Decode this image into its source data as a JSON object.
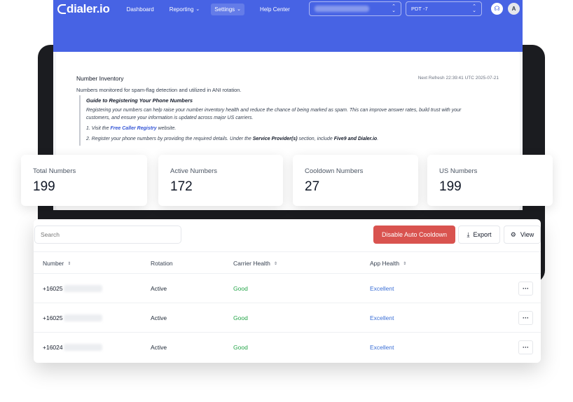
{
  "nav": {
    "logo": "dialer.io",
    "items": [
      {
        "label": "Dashboard"
      },
      {
        "label": "Reporting"
      },
      {
        "label": "Settings"
      },
      {
        "label": "Help Center"
      }
    ],
    "timezone": "PDT -7",
    "avatar_initial": "A"
  },
  "inventory": {
    "title": "Number Inventory",
    "refresh": "Next Refresh 22:39:41 UTC 2025-07-21",
    "subtitle": "Numbers monitored for spam-flag detection and utilized in ANI rotation.",
    "guide_title": "Guide to Registering Your Phone Numbers",
    "guide_body": "Registering your numbers can help raise your number inventory health and reduce the chance of being marked as spam. This can improve answer rates, build trust with your customers, and ensure your information is updated across major US carriers.",
    "step1_prefix": "1. Visit the ",
    "step1_link": "Free Caller Registry",
    "step1_suffix": " website.",
    "step2_prefix": "2. Register your phone numbers by providing the required details. Under the ",
    "step2_bold": "Service Provider(s)",
    "step2_mid": " section, include ",
    "step2_bold2": "Five9 and Dialer.io",
    "step2_end": "."
  },
  "stats": [
    {
      "label": "Total Numbers",
      "value": "199"
    },
    {
      "label": "Active Numbers",
      "value": "172"
    },
    {
      "label": "Cooldown Numbers",
      "value": "27"
    },
    {
      "label": "US Numbers",
      "value": "199"
    }
  ],
  "toolbar": {
    "search_placeholder": "Search",
    "cooldown_label": "Disable Auto Cooldown",
    "export_label": "Export",
    "view_label": "View"
  },
  "table": {
    "columns": [
      "Number",
      "Rotation",
      "Carrier Health",
      "App Health"
    ],
    "rows": [
      {
        "number": "+16025",
        "rotation": "Active",
        "carrier": "Good",
        "app": "Excellent"
      },
      {
        "number": "+16025",
        "rotation": "Active",
        "carrier": "Good",
        "app": "Excellent"
      },
      {
        "number": "+16024",
        "rotation": "Active",
        "carrier": "Good",
        "app": "Excellent"
      }
    ],
    "more_label": "···"
  },
  "colors": {
    "brand": "#4763e4",
    "danger": "#d9534f",
    "good": "#22a447",
    "excellent": "#3b6fd6"
  }
}
